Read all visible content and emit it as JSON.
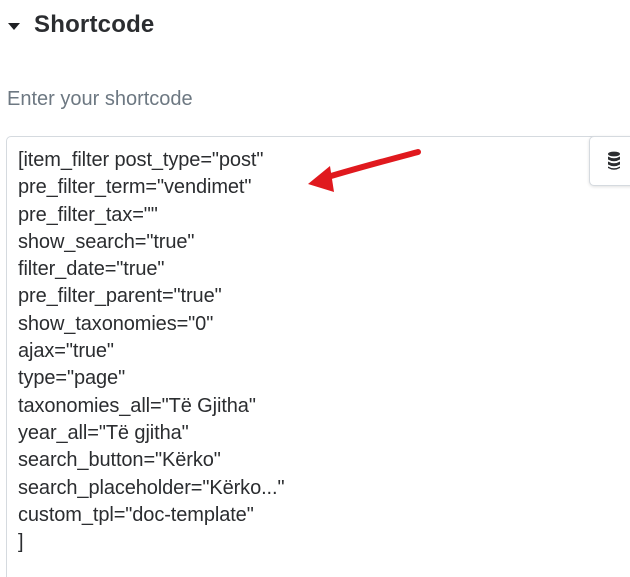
{
  "section": {
    "title": "Shortcode",
    "caret_icon": "caret-down-icon"
  },
  "field": {
    "label": "Enter your shortcode",
    "lines": [
      "[item_filter post_type=\"post\"",
      "pre_filter_term=\"vendimet\"",
      "pre_filter_tax=\"\"",
      "show_search=\"true\"",
      "filter_date=\"true\"",
      "pre_filter_parent=\"true\"",
      "show_taxonomies=\"0\"",
      "ajax=\"true\"",
      "type=\"page\"",
      "taxonomies_all=\"Të Gjitha\"",
      "year_all=\"Të gjitha\"",
      "search_button=\"Kërko\"",
      "search_placeholder=\"Kërko...\"",
      "custom_tpl=\"doc-template\"",
      "]"
    ]
  },
  "dynamic_tags_button": {
    "icon": "database-icon"
  },
  "annotation": {
    "icon": "red-arrow-icon",
    "color": "#e0191e"
  }
}
